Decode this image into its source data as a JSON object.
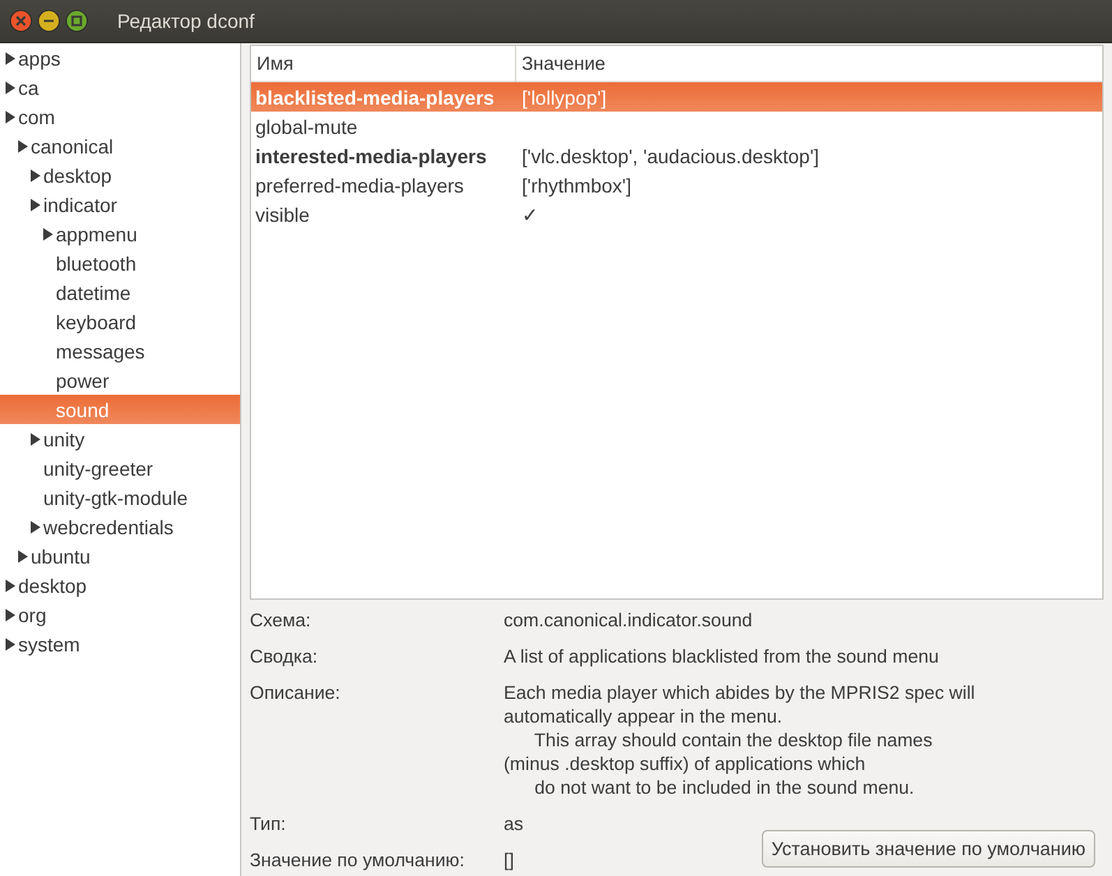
{
  "window": {
    "title": "Редактор dconf"
  },
  "tree": [
    {
      "label": "apps",
      "expandable": true,
      "selected": false
    },
    {
      "label": "ca",
      "expandable": true,
      "selected": false
    },
    {
      "label": "com",
      "expandable": true,
      "selected": false,
      "children": [
        {
          "label": "canonical",
          "expandable": true,
          "selected": false,
          "children": [
            {
              "label": "desktop",
              "expandable": true,
              "selected": false
            },
            {
              "label": "indicator",
              "expandable": true,
              "selected": false,
              "children": [
                {
                  "label": "appmenu",
                  "expandable": true,
                  "selected": false
                },
                {
                  "label": "bluetooth",
                  "expandable": false,
                  "selected": false
                },
                {
                  "label": "datetime",
                  "expandable": false,
                  "selected": false
                },
                {
                  "label": "keyboard",
                  "expandable": false,
                  "selected": false
                },
                {
                  "label": "messages",
                  "expandable": false,
                  "selected": false
                },
                {
                  "label": "power",
                  "expandable": false,
                  "selected": false
                },
                {
                  "label": "sound",
                  "expandable": false,
                  "selected": true
                }
              ]
            },
            {
              "label": "unity",
              "expandable": true,
              "selected": false
            },
            {
              "label": "unity-greeter",
              "expandable": false,
              "selected": false
            },
            {
              "label": "unity-gtk-module",
              "expandable": false,
              "selected": false
            },
            {
              "label": "webcredentials",
              "expandable": true,
              "selected": false
            }
          ]
        },
        {
          "label": "ubuntu",
          "expandable": true,
          "selected": false
        }
      ]
    },
    {
      "label": "desktop",
      "expandable": true,
      "selected": false
    },
    {
      "label": "org",
      "expandable": true,
      "selected": false
    },
    {
      "label": "system",
      "expandable": true,
      "selected": false
    }
  ],
  "keys": {
    "columns": [
      "Имя",
      "Значение"
    ],
    "rows": [
      {
        "name": "blacklisted-media-players",
        "value": "['lollypop']",
        "modified": true,
        "selected": true
      },
      {
        "name": "global-mute",
        "modified": false,
        "selected": false
      },
      {
        "name": "interested-media-players",
        "value": "['vlc.desktop', 'audacious.desktop']",
        "modified": true,
        "selected": false
      },
      {
        "name": "preferred-media-players",
        "value": "['rhythmbox']",
        "modified": false,
        "selected": false
      },
      {
        "name": "visible",
        "value": "✓",
        "modified": false,
        "selected": false
      }
    ]
  },
  "details": [
    {
      "label": "Схема:",
      "value": "com.canonical.indicator.sound"
    },
    {
      "label": "Сводка:",
      "value": "A list of applications blacklisted from the sound menu"
    },
    {
      "label": "Описание:",
      "value": "Each media player which abides by the MPRIS2 spec will\nautomatically appear in the menu.\n      This array should contain the desktop file names\n(minus .desktop suffix) of applications which\n      do not want to be included in the sound menu."
    },
    {
      "label": "Тип:",
      "value": "as"
    },
    {
      "label": "Значение по умолчанию:",
      "value": "[]"
    }
  ],
  "buttons": [
    "Установить значение по умолчанию"
  ]
}
